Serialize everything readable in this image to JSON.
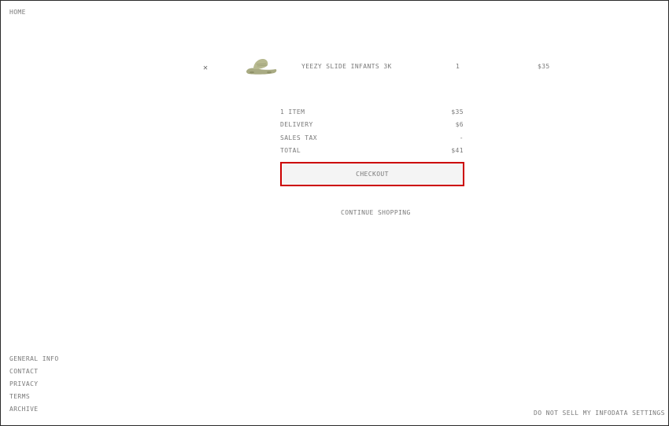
{
  "header": {
    "home": "HOME"
  },
  "cart": {
    "remove_icon": "✕",
    "item": {
      "image": "slide-sandal-icon",
      "name": "YEEZY SLIDE INFANTS 3K",
      "quantity": "1",
      "price": "$35"
    }
  },
  "summary": {
    "rows": [
      {
        "label": "1 ITEM",
        "value": "$35"
      },
      {
        "label": "DELIVERY",
        "value": "$6"
      },
      {
        "label": "SALES TAX",
        "value": "-"
      },
      {
        "label": "TOTAL",
        "value": "$41"
      }
    ],
    "checkout_label": "CHECKOUT",
    "continue_label": "CONTINUE SHOPPING"
  },
  "footer": {
    "links": [
      "GENERAL INFO",
      "CONTACT",
      "PRIVACY",
      "TERMS",
      "ARCHIVE"
    ],
    "do_not_sell": "DO NOT SELL MY INFO",
    "data_settings": "DATA SETTINGS"
  },
  "colors": {
    "text": "#7a7a7a",
    "accent_border": "#cc0000",
    "button_bg": "#f4f4f4",
    "product": "#b7b98f"
  }
}
